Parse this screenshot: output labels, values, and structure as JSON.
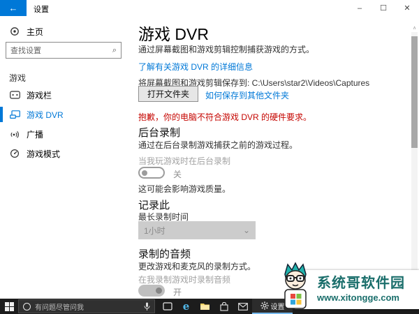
{
  "titlebar": {
    "app_title": "设置",
    "back_glyph": "←"
  },
  "window_controls": {
    "minimize": "–",
    "maximize": "☐",
    "close": "✕"
  },
  "sidebar": {
    "home_label": "主页",
    "search_placeholder": "查找设置",
    "search_icon_glyph": "⌕",
    "section_label": "游戏",
    "items": [
      {
        "label": "游戏栏"
      },
      {
        "label": "游戏 DVR"
      },
      {
        "label": "广播"
      },
      {
        "label": "游戏模式"
      }
    ]
  },
  "main": {
    "title": "游戏 DVR",
    "subtitle": "通过屏幕截图和游戏剪辑控制捕获游戏的方式。",
    "learn_more_link": "了解有关游戏 DVR 的详细信息",
    "save_path_text": "将屏幕截图和游戏剪辑保存到: C:\\Users\\star2\\Videos\\Captures",
    "open_folder_button": "打开文件夹",
    "save_elsewhere_link": "如何保存到其他文件夹",
    "warning": "抱歉，你的电脑不符合游戏 DVR 的硬件要求。",
    "background_recording": {
      "title": "后台录制",
      "desc": "通过在后台录制游戏捕获之前的游戏过程。",
      "toggle_label": "当我玩游戏时在后台录制",
      "toggle_state": "关",
      "note": "这可能会影响游戏质量。"
    },
    "record_this": {
      "title": "记录此",
      "field_label": "最长录制时间",
      "dropdown_value": "1小时",
      "chevron": "⌄"
    },
    "recorded_audio": {
      "title": "录制的音频",
      "desc": "更改游戏和麦克风的录制方式。",
      "toggle_label": "在我录制游戏时录制音频",
      "toggle_state": "开"
    }
  },
  "scrollbar": {
    "up_glyph": "∧"
  },
  "taskbar": {
    "cortana_placeholder": "有问题尽管问我",
    "settings_app_label": "设置"
  },
  "watermark": {
    "title": "系统哥软件园",
    "url": "www.xitongge.com",
    "color": "#1a6e6b"
  },
  "colors": {
    "accent": "#0078d7",
    "warning": "#c50500"
  }
}
